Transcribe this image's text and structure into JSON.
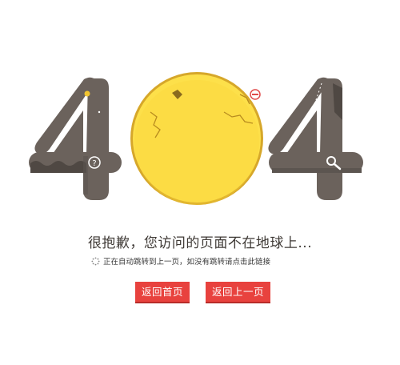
{
  "error": {
    "digit_left": "4",
    "digit_middle": "0",
    "digit_right": "4",
    "title": "很抱歉，您访问的页面不在地球上...",
    "redirect_hint": "正在自动跳转到上一页，如没有跳转请点击此链接"
  },
  "actions": {
    "home_label": "返回首页",
    "back_label": "返回上一页"
  },
  "icons": {
    "left_four_badge": "question-mark-icon",
    "right_four_badge": "magnifier-icon",
    "planet_badge": "no-entry-icon",
    "loading": "loading-spinner-icon"
  },
  "colors": {
    "digit": "#6b625c",
    "digit_dark": "#4f4843",
    "planet": "#fde04a",
    "planet_rim": "#d6a72a",
    "button": "#e8423e"
  }
}
